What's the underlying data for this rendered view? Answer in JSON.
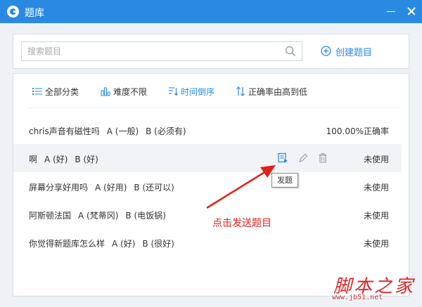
{
  "window": {
    "title": "题库"
  },
  "search": {
    "placeholder": "搜索题目",
    "value": ""
  },
  "create_button": {
    "label": "创建题目"
  },
  "filters": [
    {
      "label": "全部分类",
      "icon": "list-icon"
    },
    {
      "label": "难度不限",
      "icon": "bar-chart-icon"
    },
    {
      "label": "时间倒序",
      "icon": "sort-time-icon"
    },
    {
      "label": "正确率由高到低",
      "icon": "sort-arrows-icon"
    }
  ],
  "questions": [
    {
      "text": "chris声音有磁性吗",
      "options": [
        "A (一般)",
        "B (必须有)"
      ],
      "status": "100.00%正确率"
    },
    {
      "text": "啊",
      "options": [
        "A (好)",
        "B (好)"
      ],
      "status": "未使用"
    },
    {
      "text": "屏幕分享好用吗",
      "options": [
        "A (好用)",
        "B (还可以)"
      ],
      "status": "未使用"
    },
    {
      "text": "阿斯顿法国",
      "options": [
        "A (梵蒂冈)",
        "B (电饭锅)"
      ],
      "status": "未使用"
    },
    {
      "text": "你觉得新题库怎么样",
      "options": [
        "A (好)",
        "B (很好)"
      ],
      "status": "未使用"
    }
  ],
  "tooltip": "发题",
  "annotation": "点击发送题目",
  "watermark": {
    "logo_text": "脚本之家",
    "url": "www.jb51.net"
  },
  "colors": {
    "accent": "#2a8ae2",
    "annotation": "#e0221b",
    "watermark": "#d22b2b"
  }
}
